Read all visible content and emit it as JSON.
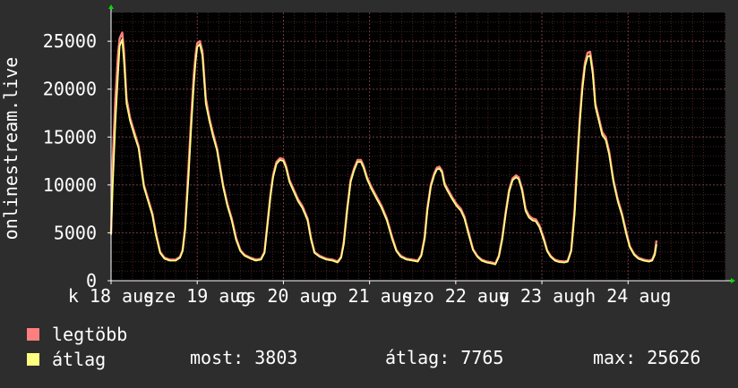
{
  "chart_data": {
    "type": "line",
    "ylabel": "onlinestream.live",
    "ylim": [
      0,
      28000
    ],
    "y_ticks": [
      0,
      5000,
      10000,
      15000,
      20000,
      25000
    ],
    "y_tick_labels": [
      "0",
      "5000",
      "10000",
      "15000",
      "20000",
      "25000"
    ],
    "xlim": [
      0,
      7.13
    ],
    "x_ticks": [
      0,
      1,
      2,
      3,
      4,
      5,
      6
    ],
    "x_tick_labels": [
      "k 18 aug",
      "sze 19 aug",
      "cs 20 aug",
      "p 21 aug",
      "szo 22 aug",
      "v 23 aug",
      "h 24 aug"
    ],
    "grid": true,
    "colors": {
      "max": "#ff7f7f",
      "avg": "#ffff80",
      "grid": "#7a3c3c",
      "axis": "#ffffff",
      "arrow": "#00dd00",
      "background": "#2d2d2d",
      "plot": "#000000"
    },
    "series": [
      {
        "name": "legtöbb",
        "color": "#ff7f7f",
        "points": [
          [
            0,
            5000
          ],
          [
            0.02,
            12500
          ],
          [
            0.05,
            19000
          ],
          [
            0.08,
            23500
          ],
          [
            0.1,
            25300
          ],
          [
            0.13,
            25900
          ],
          [
            0.15,
            24000
          ],
          [
            0.18,
            19000
          ],
          [
            0.22,
            17000
          ],
          [
            0.27,
            15500
          ],
          [
            0.32,
            14000
          ],
          [
            0.38,
            10000
          ],
          [
            0.43,
            8500
          ],
          [
            0.48,
            7000
          ],
          [
            0.52,
            5000
          ],
          [
            0.57,
            3000
          ],
          [
            0.62,
            2400
          ],
          [
            0.68,
            2200
          ],
          [
            0.75,
            2200
          ],
          [
            0.8,
            2500
          ],
          [
            0.83,
            3200
          ],
          [
            0.86,
            5500
          ],
          [
            0.9,
            12000
          ],
          [
            0.93,
            17000
          ],
          [
            0.96,
            21500
          ],
          [
            0.98,
            23500
          ],
          [
            1.0,
            24800
          ],
          [
            1.03,
            25000
          ],
          [
            1.06,
            24000
          ],
          [
            1.1,
            19000
          ],
          [
            1.14,
            17000
          ],
          [
            1.18,
            15500
          ],
          [
            1.23,
            13800
          ],
          [
            1.3,
            10000
          ],
          [
            1.35,
            8000
          ],
          [
            1.4,
            6500
          ],
          [
            1.45,
            4500
          ],
          [
            1.5,
            3200
          ],
          [
            1.55,
            2700
          ],
          [
            1.62,
            2400
          ],
          [
            1.68,
            2200
          ],
          [
            1.74,
            2300
          ],
          [
            1.78,
            3000
          ],
          [
            1.81,
            5500
          ],
          [
            1.85,
            9000
          ],
          [
            1.88,
            11000
          ],
          [
            1.92,
            12400
          ],
          [
            1.96,
            12800
          ],
          [
            2.0,
            12700
          ],
          [
            2.03,
            12000
          ],
          [
            2.07,
            10500
          ],
          [
            2.12,
            9500
          ],
          [
            2.17,
            8500
          ],
          [
            2.22,
            7800
          ],
          [
            2.28,
            6500
          ],
          [
            2.32,
            4500
          ],
          [
            2.36,
            3000
          ],
          [
            2.42,
            2600
          ],
          [
            2.5,
            2300
          ],
          [
            2.57,
            2200
          ],
          [
            2.63,
            2000
          ],
          [
            2.67,
            2500
          ],
          [
            2.7,
            4000
          ],
          [
            2.74,
            7500
          ],
          [
            2.78,
            10500
          ],
          [
            2.82,
            11700
          ],
          [
            2.86,
            12600
          ],
          [
            2.9,
            12600
          ],
          [
            2.93,
            12000
          ],
          [
            2.97,
            10800
          ],
          [
            3.02,
            9800
          ],
          [
            3.08,
            8800
          ],
          [
            3.14,
            7800
          ],
          [
            3.2,
            6500
          ],
          [
            3.26,
            4600
          ],
          [
            3.31,
            3200
          ],
          [
            3.36,
            2600
          ],
          [
            3.43,
            2300
          ],
          [
            3.5,
            2200
          ],
          [
            3.56,
            2100
          ],
          [
            3.6,
            2700
          ],
          [
            3.64,
            4600
          ],
          [
            3.67,
            7500
          ],
          [
            3.71,
            10000
          ],
          [
            3.75,
            11200
          ],
          [
            3.78,
            11800
          ],
          [
            3.81,
            11900
          ],
          [
            3.84,
            11500
          ],
          [
            3.87,
            10200
          ],
          [
            3.91,
            9500
          ],
          [
            3.96,
            8700
          ],
          [
            4.01,
            8000
          ],
          [
            4.06,
            7500
          ],
          [
            4.1,
            6700
          ],
          [
            4.15,
            5000
          ],
          [
            4.2,
            3300
          ],
          [
            4.25,
            2600
          ],
          [
            4.3,
            2200
          ],
          [
            4.36,
            2000
          ],
          [
            4.42,
            1900
          ],
          [
            4.46,
            1800
          ],
          [
            4.5,
            2600
          ],
          [
            4.54,
            4500
          ],
          [
            4.58,
            7200
          ],
          [
            4.62,
            9500
          ],
          [
            4.66,
            10700
          ],
          [
            4.7,
            11000
          ],
          [
            4.73,
            10800
          ],
          [
            4.77,
            9600
          ],
          [
            4.81,
            7500
          ],
          [
            4.85,
            6800
          ],
          [
            4.89,
            6500
          ],
          [
            4.93,
            6400
          ],
          [
            4.97,
            5800
          ],
          [
            5.02,
            4500
          ],
          [
            5.06,
            3200
          ],
          [
            5.1,
            2600
          ],
          [
            5.15,
            2200
          ],
          [
            5.2,
            2050
          ],
          [
            5.26,
            2000
          ],
          [
            5.3,
            2100
          ],
          [
            5.34,
            3200
          ],
          [
            5.38,
            7500
          ],
          [
            5.41,
            12500
          ],
          [
            5.44,
            17000
          ],
          [
            5.47,
            20500
          ],
          [
            5.5,
            22800
          ],
          [
            5.53,
            23800
          ],
          [
            5.56,
            23900
          ],
          [
            5.59,
            22000
          ],
          [
            5.62,
            18500
          ],
          [
            5.66,
            17000
          ],
          [
            5.7,
            15500
          ],
          [
            5.74,
            15000
          ],
          [
            5.78,
            13500
          ],
          [
            5.83,
            10500
          ],
          [
            5.88,
            8500
          ],
          [
            5.93,
            7000
          ],
          [
            5.98,
            5000
          ],
          [
            6.02,
            3600
          ],
          [
            6.07,
            2800
          ],
          [
            6.12,
            2400
          ],
          [
            6.18,
            2200
          ],
          [
            6.24,
            2100
          ],
          [
            6.28,
            2200
          ],
          [
            6.31,
            2900
          ],
          [
            6.33,
            4200
          ]
        ]
      },
      {
        "name": "átlag",
        "color": "#ffff80",
        "points": [
          [
            0,
            4800
          ],
          [
            0.02,
            10000
          ],
          [
            0.05,
            16500
          ],
          [
            0.08,
            21500
          ],
          [
            0.1,
            24500
          ],
          [
            0.13,
            25200
          ],
          [
            0.15,
            23000
          ],
          [
            0.18,
            18500
          ],
          [
            0.22,
            16700
          ],
          [
            0.27,
            15200
          ],
          [
            0.32,
            13800
          ],
          [
            0.38,
            9800
          ],
          [
            0.43,
            8300
          ],
          [
            0.48,
            6800
          ],
          [
            0.52,
            4800
          ],
          [
            0.57,
            2900
          ],
          [
            0.62,
            2300
          ],
          [
            0.68,
            2100
          ],
          [
            0.75,
            2100
          ],
          [
            0.8,
            2400
          ],
          [
            0.83,
            3100
          ],
          [
            0.86,
            5300
          ],
          [
            0.9,
            11000
          ],
          [
            0.93,
            16000
          ],
          [
            0.96,
            20500
          ],
          [
            0.98,
            22800
          ],
          [
            1.0,
            24400
          ],
          [
            1.03,
            24700
          ],
          [
            1.06,
            23500
          ],
          [
            1.1,
            18500
          ],
          [
            1.14,
            16700
          ],
          [
            1.18,
            15200
          ],
          [
            1.23,
            13600
          ],
          [
            1.3,
            9800
          ],
          [
            1.35,
            7800
          ],
          [
            1.4,
            6300
          ],
          [
            1.45,
            4300
          ],
          [
            1.5,
            3100
          ],
          [
            1.55,
            2600
          ],
          [
            1.62,
            2300
          ],
          [
            1.68,
            2100
          ],
          [
            1.74,
            2200
          ],
          [
            1.78,
            2900
          ],
          [
            1.81,
            5300
          ],
          [
            1.85,
            8800
          ],
          [
            1.88,
            10800
          ],
          [
            1.92,
            12200
          ],
          [
            1.96,
            12600
          ],
          [
            2.0,
            12500
          ],
          [
            2.03,
            11800
          ],
          [
            2.07,
            10300
          ],
          [
            2.12,
            9300
          ],
          [
            2.17,
            8300
          ],
          [
            2.22,
            7600
          ],
          [
            2.28,
            6300
          ],
          [
            2.32,
            4300
          ],
          [
            2.36,
            2900
          ],
          [
            2.42,
            2500
          ],
          [
            2.5,
            2200
          ],
          [
            2.57,
            2100
          ],
          [
            2.63,
            1900
          ],
          [
            2.67,
            2400
          ],
          [
            2.7,
            3800
          ],
          [
            2.74,
            7300
          ],
          [
            2.78,
            10300
          ],
          [
            2.82,
            11500
          ],
          [
            2.86,
            12400
          ],
          [
            2.9,
            12400
          ],
          [
            2.93,
            11800
          ],
          [
            2.97,
            10600
          ],
          [
            3.02,
            9600
          ],
          [
            3.08,
            8600
          ],
          [
            3.14,
            7600
          ],
          [
            3.2,
            6300
          ],
          [
            3.26,
            4400
          ],
          [
            3.31,
            3100
          ],
          [
            3.36,
            2500
          ],
          [
            3.43,
            2200
          ],
          [
            3.5,
            2100
          ],
          [
            3.56,
            2000
          ],
          [
            3.6,
            2600
          ],
          [
            3.64,
            4400
          ],
          [
            3.67,
            7300
          ],
          [
            3.71,
            9800
          ],
          [
            3.75,
            11000
          ],
          [
            3.78,
            11600
          ],
          [
            3.81,
            11700
          ],
          [
            3.84,
            11300
          ],
          [
            3.87,
            10000
          ],
          [
            3.91,
            9300
          ],
          [
            3.96,
            8500
          ],
          [
            4.01,
            7800
          ],
          [
            4.06,
            7300
          ],
          [
            4.1,
            6500
          ],
          [
            4.15,
            4800
          ],
          [
            4.2,
            3200
          ],
          [
            4.25,
            2500
          ],
          [
            4.3,
            2100
          ],
          [
            4.36,
            1900
          ],
          [
            4.42,
            1800
          ],
          [
            4.46,
            1700
          ],
          [
            4.5,
            2500
          ],
          [
            4.54,
            4300
          ],
          [
            4.58,
            7000
          ],
          [
            4.62,
            9300
          ],
          [
            4.66,
            10500
          ],
          [
            4.7,
            10800
          ],
          [
            4.73,
            10600
          ],
          [
            4.77,
            9400
          ],
          [
            4.81,
            7300
          ],
          [
            4.85,
            6600
          ],
          [
            4.89,
            6300
          ],
          [
            4.93,
            6200
          ],
          [
            4.97,
            5600
          ],
          [
            5.02,
            4300
          ],
          [
            5.06,
            3100
          ],
          [
            5.1,
            2500
          ],
          [
            5.15,
            2100
          ],
          [
            5.2,
            1950
          ],
          [
            5.26,
            1900
          ],
          [
            5.3,
            2000
          ],
          [
            5.34,
            3100
          ],
          [
            5.38,
            7000
          ],
          [
            5.41,
            12000
          ],
          [
            5.44,
            16500
          ],
          [
            5.47,
            20000
          ],
          [
            5.5,
            22400
          ],
          [
            5.53,
            23400
          ],
          [
            5.56,
            23500
          ],
          [
            5.59,
            21600
          ],
          [
            5.62,
            18200
          ],
          [
            5.66,
            16700
          ],
          [
            5.7,
            15200
          ],
          [
            5.74,
            14700
          ],
          [
            5.78,
            13200
          ],
          [
            5.83,
            10300
          ],
          [
            5.88,
            8300
          ],
          [
            5.93,
            6800
          ],
          [
            5.98,
            4800
          ],
          [
            6.02,
            3500
          ],
          [
            6.07,
            2700
          ],
          [
            6.12,
            2300
          ],
          [
            6.18,
            2100
          ],
          [
            6.24,
            2000
          ],
          [
            6.28,
            2100
          ],
          [
            6.31,
            2700
          ],
          [
            6.33,
            3803
          ]
        ]
      }
    ]
  },
  "legend": {
    "max_label": "legtöbb",
    "avg_label": "átlag",
    "max_color": "#ff7f7f",
    "avg_color": "#ffff80"
  },
  "stats": {
    "current": "most: 3803",
    "average": "átlag: 7765",
    "maximum": "max: 25626"
  }
}
